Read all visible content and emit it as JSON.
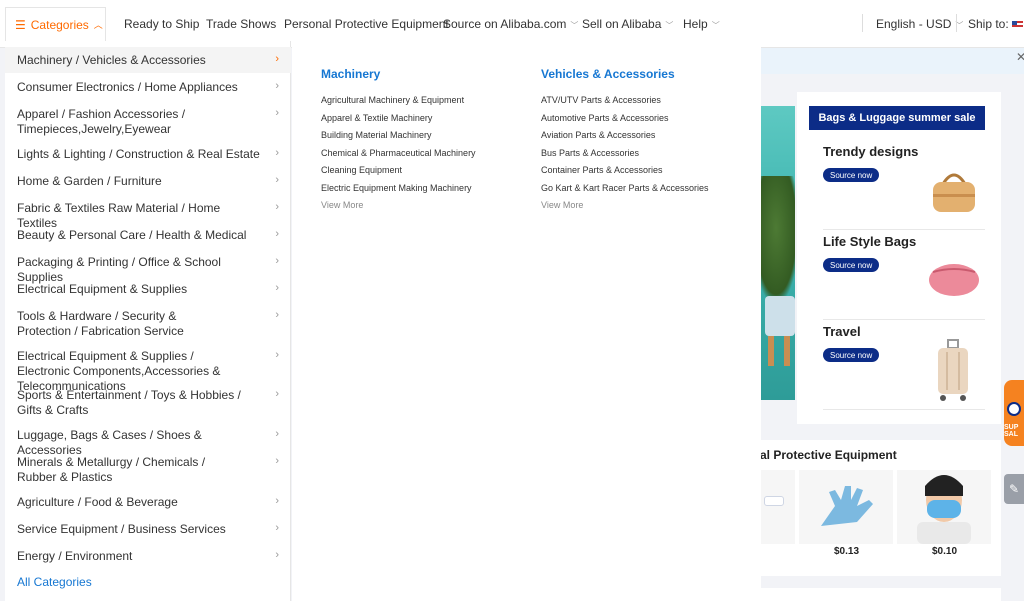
{
  "nav": {
    "categories_label": "Categories",
    "items": [
      "Ready to Ship",
      "Trade Shows",
      "Personal Protective Equipment",
      "Source on Alibaba.com",
      "Sell on Alibaba",
      "Help"
    ],
    "language": "English - USD",
    "ship_to": "Ship to:"
  },
  "categories": [
    {
      "label": "Machinery / Vehicles & Accessories"
    },
    {
      "label": "Consumer Electronics / Home Appliances"
    },
    {
      "label": "Apparel / Fashion Accessories / Timepieces,Jewelry,Eyewear"
    },
    {
      "label": "Lights & Lighting / Construction & Real Estate"
    },
    {
      "label": "Home & Garden / Furniture"
    },
    {
      "label": "Fabric & Textiles Raw Material / Home Textiles"
    },
    {
      "label": "Beauty & Personal Care / Health & Medical"
    },
    {
      "label": "Packaging & Printing / Office & School Supplies"
    },
    {
      "label": "Electrical Equipment & Supplies"
    },
    {
      "label": "Tools & Hardware / Security & Protection / Fabrication Service"
    },
    {
      "label": "Electrical Equipment & Supplies / Electronic Components,Accessories & Telecommunications"
    },
    {
      "label": "Sports & Entertainment / Toys & Hobbies / Gifts & Crafts"
    },
    {
      "label": "Luggage, Bags & Cases / Shoes & Accessories"
    },
    {
      "label": "Minerals & Metallurgy / Chemicals / Rubber & Plastics"
    },
    {
      "label": "Agriculture / Food & Beverage"
    },
    {
      "label": "Service Equipment / Business Services"
    },
    {
      "label": "Energy / Environment"
    }
  ],
  "all_categories": "All Categories",
  "flyout": {
    "columns": [
      {
        "heading": "Machinery",
        "links": [
          "Agricultural Machinery & Equipment",
          "Apparel & Textile Machinery",
          "Building Material Machinery",
          "Chemical & Pharmaceutical Machinery",
          "Cleaning Equipment",
          "Electric Equipment Making Machinery"
        ],
        "more": "View More"
      },
      {
        "heading": "Vehicles & Accessories",
        "links": [
          "ATV/UTV Parts & Accessories",
          "Automotive Parts & Accessories",
          "Aviation Parts & Accessories",
          "Bus Parts & Accessories",
          "Container Parts & Accessories",
          "Go Kart & Kart Racer Parts & Accessories"
        ],
        "more": "View More"
      }
    ]
  },
  "promo": {
    "banner": "Bags & Luggage summer sale",
    "items": [
      {
        "title": "Trendy designs",
        "button": "Source now",
        "icon": "handbag-icon"
      },
      {
        "title": "Life Style Bags",
        "button": "Source now",
        "icon": "pouch-icon"
      },
      {
        "title": "Travel",
        "button": "Source now",
        "icon": "suitcase-icon"
      }
    ]
  },
  "ppe": {
    "title": "al Protective Equipment",
    "prices": [
      "$0.13",
      "$0.10"
    ]
  },
  "side_badge": "SUP SAL",
  "colors": {
    "accent": "#ff6a00",
    "link": "#1677d2",
    "navy": "#0c2c87"
  }
}
